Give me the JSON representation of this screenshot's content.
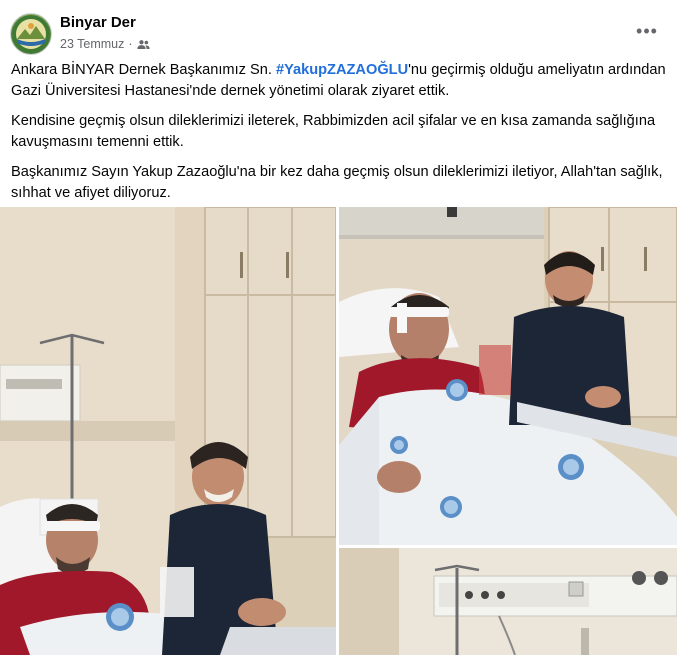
{
  "post": {
    "author": "Binyar Der",
    "date": "23 Temmuz",
    "separator": "·",
    "audience_icon": "friends-icon",
    "more_icon": "more-options-icon",
    "more_label": "•••",
    "paragraphs": {
      "p1_before": "Ankara BİNYAR Dernek Başkanımız Sn. ",
      "p1_hashtag": "#YakupZAZAOĞLU",
      "p1_after": "'nu geçirmiş olduğu ameliyatın ardından Gazi Üniversitesi Hastanesi'nde dernek yönetimi olarak ziyaret ettik.",
      "p2": "Kendisine geçmiş olsun dileklerimizi ileterek, Rabbimizden acil şifalar ve en kısa zamanda sağlığına kavuşmasını temenni ettik.",
      "p3": "Başkanımız Sayın Yakup Zazaoğlu'na bir kez daha geçmiş olsun dileklerimizi iletiyor, Allah'tan sağlık, sıhhat ve afiyet diliyoruz."
    }
  },
  "colors": {
    "link": "#216fdb",
    "secondary_text": "#65676b",
    "shirt_red": "#a0182a",
    "shirt_navy": "#1d2636",
    "wall": "#e4d6c2",
    "sheet": "#eef1f4",
    "emblem": "#5a8fc8"
  },
  "gallery": {
    "photos": [
      {
        "name": "photo-visit-left"
      },
      {
        "name": "photo-visit-right"
      },
      {
        "name": "photo-medical-panel"
      }
    ]
  }
}
